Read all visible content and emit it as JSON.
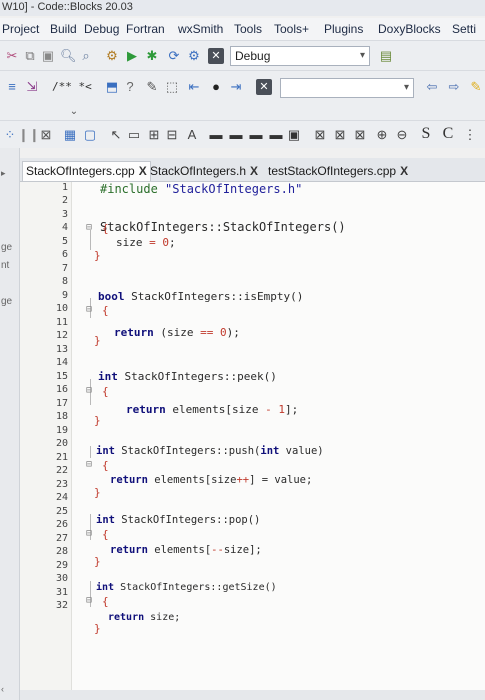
{
  "window": {
    "title": "W10] - Code::Blocks 20.03"
  },
  "menu": [
    "Project",
    "Build",
    "Debug",
    "Fortran",
    "wxSmith",
    "Tools",
    "Tools+",
    "Plugins",
    "DoxyBlocks",
    "Setti"
  ],
  "toolbar": {
    "build_target": "Debug",
    "comment_label": "/** *<"
  },
  "side_fragments": [
    "ge",
    "nt",
    "ge"
  ],
  "tabs": [
    {
      "label": "StackOfIntegers.cpp",
      "close": "X",
      "active": true
    },
    {
      "label": "StackOfIntegers.h",
      "close": "X",
      "active": false
    },
    {
      "label": "testStackOfIntegers.cpp",
      "close": "X",
      "active": false
    }
  ],
  "line_numbers": [
    "1",
    "2",
    "3",
    "4",
    "5",
    "6",
    "7",
    "8",
    "9",
    "10",
    "11",
    "12",
    "13",
    "14",
    "15",
    "16",
    "17",
    "18",
    "19",
    "20",
    "21",
    "22",
    "23",
    "24",
    "25",
    "26",
    "27",
    "28",
    "29",
    "30",
    "31",
    "32"
  ],
  "code": {
    "l1": {
      "pp": "#include ",
      "str": "\"StackOfIntegers.h\""
    },
    "l3": {
      "a": "StackOfIntegers::StackOfIntegers()"
    },
    "l4": {
      "brace": "{"
    },
    "l5": {
      "a": "size ",
      "op": "= ",
      "num": "0",
      "b": ";"
    },
    "l6": {
      "brace": "}"
    },
    "l8": {
      "kw": "bool ",
      "a": "StackOfIntegers::isEmpty()"
    },
    "l9": {
      "brace": "{"
    },
    "l10": {
      "kw": "return ",
      "a": "(size ",
      "op": "== ",
      "num": "0",
      "b": ");"
    },
    "l11": {
      "brace": "}"
    },
    "l13": {
      "kw": "int ",
      "a": "StackOfIntegers::peek()"
    },
    "l14": {
      "brace": "{"
    },
    "l15": {
      "kw": "return ",
      "a": "elements[size ",
      "op": "- ",
      "num": "1",
      "b": "];"
    },
    "l16": {
      "brace": "}"
    },
    "l18": {
      "kw": "int ",
      "a": "StackOfIntegers::push(",
      "kw2": "int ",
      "b": "value)"
    },
    "l19": {
      "brace": "{"
    },
    "l20": {
      "kw": "return ",
      "a": "elements[size",
      "op": "++",
      "b": "] = value;"
    },
    "l21": {
      "brace": "}"
    },
    "l23": {
      "kw": "int ",
      "a": "StackOfIntegers::pop()"
    },
    "l24": {
      "brace": "{"
    },
    "l25": {
      "kw": "return ",
      "a": "elements[",
      "op": "--",
      "b": "size];"
    },
    "l26": {
      "brace": "}"
    },
    "l28": {
      "kw": "int ",
      "a": "StackOfIntegers::getSize()"
    },
    "l29": {
      "brace": "{"
    },
    "l30": {
      "kw": "return ",
      "a": "size;"
    },
    "l31": {
      "brace": "}"
    }
  },
  "icons": {
    "run": "run-icon",
    "build": "build-icon",
    "stop": "stop-icon",
    "zoom_in": "zoom-in-icon",
    "zoom_out": "zoom-out-icon",
    "back": "back-arrow-icon",
    "forward": "forward-arrow-icon"
  },
  "colors": {
    "keyword": "#10107a",
    "number": "#c0392b",
    "string": "#1f1f9a",
    "editor_bg": "#fbfbfa"
  }
}
